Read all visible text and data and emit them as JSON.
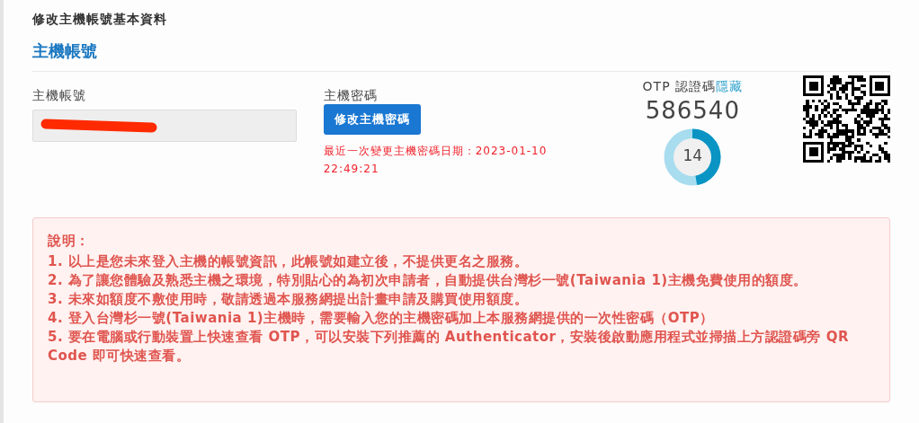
{
  "page_title": "修改主機帳號基本資料",
  "section_title": "主機帳號",
  "account": {
    "label": "主機帳號",
    "redacted": true
  },
  "password": {
    "label": "主機密碼",
    "button": "修改主機密碼",
    "last_changed": "最近一次變更主機密碼日期：2023-01-10 22:49:21"
  },
  "otp": {
    "label": "OTP 認證碼",
    "toggle_link": "隱藏",
    "code": "586540",
    "countdown": "14",
    "level": 0.47
  },
  "notice": {
    "title": "說明：",
    "items": [
      "1. 以上是您未來登入主機的帳號資訊，此帳號如建立後，不提供更名之服務。",
      "2. 為了讓您體驗及熟悉主機之環境，特別貼心的為初次申請者，自動提供台灣杉一號(Taiwania 1)主機免費使用的額度。",
      "3. 未來如額度不敷使用時，敬請透過本服務網提出計畫申請及購買使用額度。",
      "4. 登入台灣杉一號(Taiwania 1)主機時，需要輸入您的主機密碼加上本服務網提供的一次性密碼（OTP）",
      "5. 要在電腦或行動裝置上快速查看 OTP，可以安裝下列推薦的 Authenticator，安裝後啟動應用程式並掃描上方認證碼旁 QR Code 即可快速查看。"
    ]
  }
}
